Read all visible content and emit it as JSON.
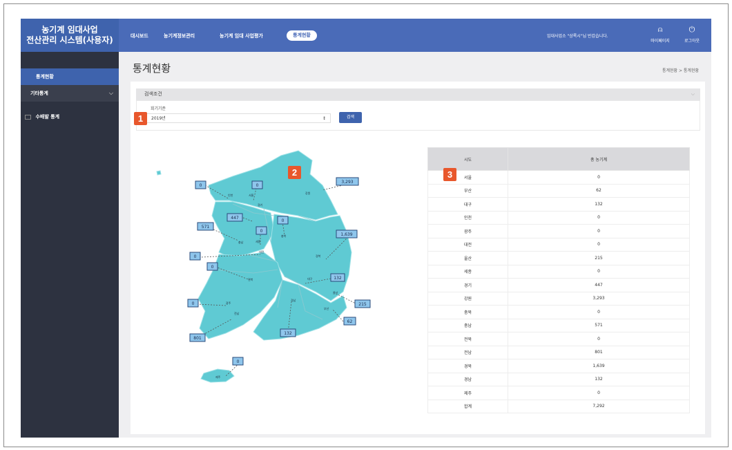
{
  "app": {
    "title_line1": "농기계 임대사업",
    "title_line2": "전산관리 시스템(사용자)"
  },
  "sidebar": {
    "items": [
      {
        "label": "통계현황"
      },
      {
        "label": "기타통계"
      },
      {
        "label": "수배발 통계"
      }
    ]
  },
  "topnav": {
    "items": [
      {
        "label": "대시보드"
      },
      {
        "label": "농기계정보관리"
      },
      {
        "label": "농기계 임대 사업평가"
      },
      {
        "label": "통계현황"
      }
    ],
    "welcome": "임대사업소 \"상록시\"님 반갑습니다.",
    "mypage_label": "마이페이지",
    "logout_label": "로그아웃"
  },
  "page": {
    "title": "통계현황",
    "breadcrumb": "통계현황 > 통계현황"
  },
  "search": {
    "header": "검색조건",
    "label": "회기기준",
    "select_value": "2019년",
    "button": "검색"
  },
  "badges": [
    "1",
    "2",
    "3"
  ],
  "map": {
    "labels": [
      {
        "name": "서울",
        "value": "0"
      },
      {
        "name": "인천",
        "value": "0"
      },
      {
        "name": "경기",
        "value": "447"
      },
      {
        "name": "강원",
        "value": "3,293"
      },
      {
        "name": "충남",
        "value": "571"
      },
      {
        "name": "세종",
        "value": "0"
      },
      {
        "name": "충북",
        "value": "0"
      },
      {
        "name": "대전",
        "value": "0"
      },
      {
        "name": "경북",
        "value": "1,639"
      },
      {
        "name": "전북",
        "value": "0"
      },
      {
        "name": "대구",
        "value": "132"
      },
      {
        "name": "울산",
        "value": "215"
      },
      {
        "name": "부산",
        "value": "62"
      },
      {
        "name": "광주",
        "value": "0"
      },
      {
        "name": "전남",
        "value": "801"
      },
      {
        "name": "경남",
        "value": "132"
      },
      {
        "name": "제주",
        "value": "0"
      }
    ]
  },
  "table": {
    "headers": [
      "시도",
      "총 농기계"
    ],
    "rows": [
      [
        "서울",
        "0"
      ],
      [
        "부산",
        "62"
      ],
      [
        "대구",
        "132"
      ],
      [
        "인천",
        "0"
      ],
      [
        "광주",
        "0"
      ],
      [
        "대전",
        "0"
      ],
      [
        "울산",
        "215"
      ],
      [
        "세종",
        "0"
      ],
      [
        "경기",
        "447"
      ],
      [
        "강원",
        "3,293"
      ],
      [
        "충북",
        "0"
      ],
      [
        "충남",
        "571"
      ],
      [
        "전북",
        "0"
      ],
      [
        "전남",
        "801"
      ],
      [
        "경북",
        "1,639"
      ],
      [
        "경남",
        "132"
      ],
      [
        "제주",
        "0"
      ],
      [
        "합계",
        "7,292"
      ]
    ]
  }
}
